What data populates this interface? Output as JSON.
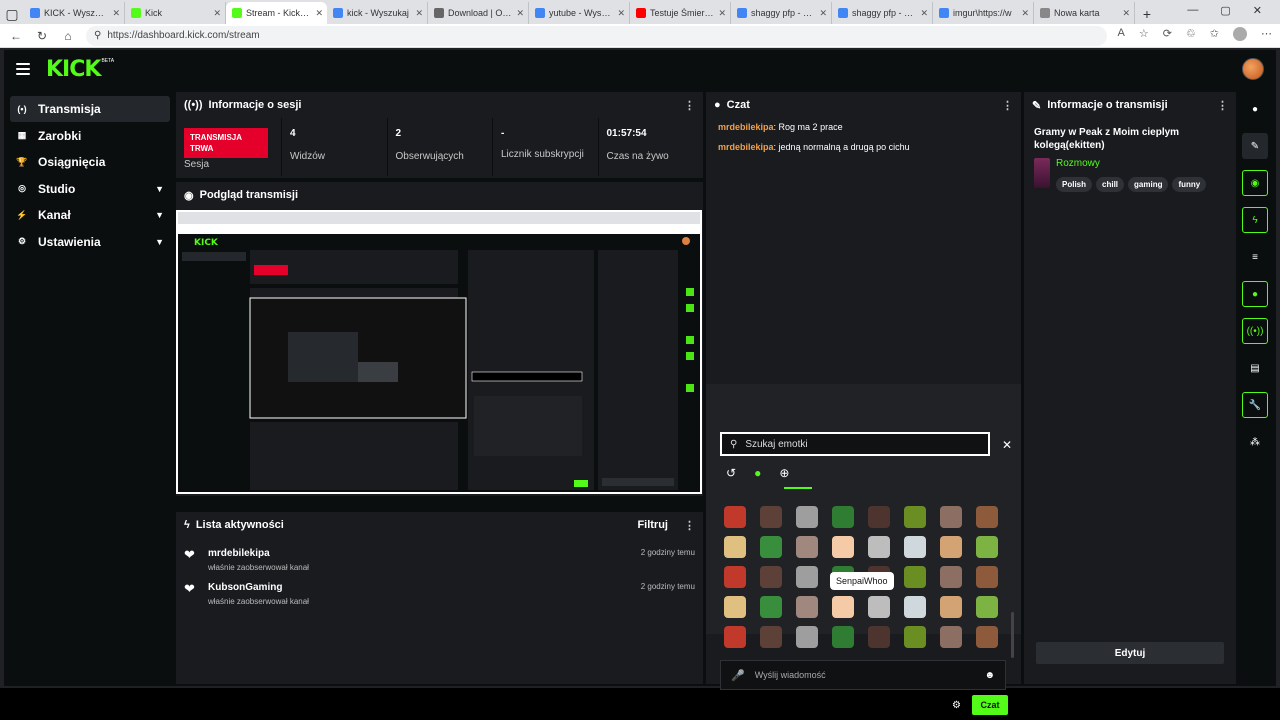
{
  "browser": {
    "tabs": [
      {
        "label": "KICK - Wyszukaj",
        "color": "#4285f4",
        "active": false
      },
      {
        "label": "Kick",
        "color": "#53fc18",
        "active": false
      },
      {
        "label": "Stream - Kick Da",
        "color": "#53fc18",
        "active": true
      },
      {
        "label": "kick - Wyszukaj",
        "color": "#4285f4",
        "active": false
      },
      {
        "label": "Download | OBS",
        "color": "#666666",
        "active": false
      },
      {
        "label": "yutube - Wyszuk",
        "color": "#4285f4",
        "active": false
      },
      {
        "label": "Testuje Śmierci z",
        "color": "#ff0000",
        "active": false
      },
      {
        "label": "shaggy pfp - Wy",
        "color": "#4285f4",
        "active": false
      },
      {
        "label": "shaggy pfp - Wy",
        "color": "#4285f4",
        "active": false
      },
      {
        "label": "imgur\\https://w",
        "color": "#4285f4",
        "active": false
      },
      {
        "label": "Nowa karta",
        "color": "#888888",
        "active": false
      }
    ],
    "url": "https://dashboard.kick.com/stream"
  },
  "app": {
    "logo": "KICK",
    "beta": "BETA"
  },
  "sidebar": {
    "items": [
      {
        "label": "Transmisja",
        "icon": "broadcast-icon",
        "glyph": "(•)",
        "active": true,
        "expandable": false
      },
      {
        "label": "Zarobki",
        "icon": "earnings-icon",
        "glyph": "▦",
        "active": false,
        "expandable": false
      },
      {
        "label": "Osiągnięcia",
        "icon": "trophy-icon",
        "glyph": "🏆",
        "active": false,
        "expandable": false
      },
      {
        "label": "Studio",
        "icon": "studio-icon",
        "glyph": "◎",
        "active": false,
        "expandable": true
      },
      {
        "label": "Kanał",
        "icon": "channel-icon",
        "glyph": "⚡",
        "active": false,
        "expandable": true
      },
      {
        "label": "Ustawienia",
        "icon": "settings-icon",
        "glyph": "⚙",
        "active": false,
        "expandable": true
      }
    ]
  },
  "session": {
    "title": "Informacje o sesji",
    "live_badge": "TRANSMISJA TRWA",
    "session_label": "Sesja",
    "stats": [
      {
        "value": "4",
        "label": "Widzów"
      },
      {
        "value": "2",
        "label": "Obserwujących"
      },
      {
        "value": "-",
        "label": "Licznik subskrypcji"
      },
      {
        "value": "01:57:54",
        "label": "Czas na żywo"
      }
    ]
  },
  "preview": {
    "title": "Podgląd transmisji"
  },
  "activity": {
    "title": "Lista aktywności",
    "filter_label": "Filtruj",
    "items": [
      {
        "user": "mrdebilekipa",
        "action": "właśnie zaobserwował kanał",
        "time": "2 godziny temu"
      },
      {
        "user": "KubsonGaming",
        "action": "właśnie zaobserwował kanał",
        "time": "2 godziny temu"
      }
    ]
  },
  "chat": {
    "title": "Czat",
    "messages": [
      {
        "nick": "mrdebilekipa",
        "text": "Rog ma 2 prace"
      },
      {
        "nick": "mrdebilekipa",
        "text": "jedną normalną a drugą po cichu"
      }
    ],
    "emote_search_placeholder": "Szukaj emotki",
    "tooltip": "SenpaiWhoo",
    "send_placeholder": "Wyślij wiadomość",
    "send_label": "Czat"
  },
  "stream_info": {
    "panel_title": "Informacje o transmisji",
    "title": "Gramy w Peak z Moim cieplym kolegą(ekitten)",
    "category": "Rozmowy",
    "tags": [
      "Polish",
      "chill",
      "gaming",
      "funny"
    ],
    "edit_label": "Edytuj"
  },
  "rail": {
    "buttons": [
      {
        "icon": "info-icon",
        "glyph": "●",
        "style": "plain"
      },
      {
        "icon": "pencil-icon",
        "glyph": "✎",
        "style": "boxed"
      },
      {
        "icon": "camera-icon",
        "glyph": "◉",
        "style": "green"
      },
      {
        "icon": "bolt-icon",
        "glyph": "ϟ",
        "style": "green"
      },
      {
        "icon": "notes-icon",
        "glyph": "≡",
        "style": "plain"
      },
      {
        "icon": "chat-bubble-icon",
        "glyph": "●",
        "style": "green"
      },
      {
        "icon": "broadcast-icon",
        "glyph": "((•))",
        "style": "green"
      },
      {
        "icon": "stack-icon",
        "glyph": "▤",
        "style": "plain"
      },
      {
        "icon": "wrench-icon",
        "glyph": "🔧",
        "style": "green"
      },
      {
        "icon": "users-icon",
        "glyph": "⁂",
        "style": "plain"
      }
    ]
  },
  "colors": {
    "accent": "#53fc18",
    "live": "#e4002b",
    "nick": "#f0a04b"
  }
}
